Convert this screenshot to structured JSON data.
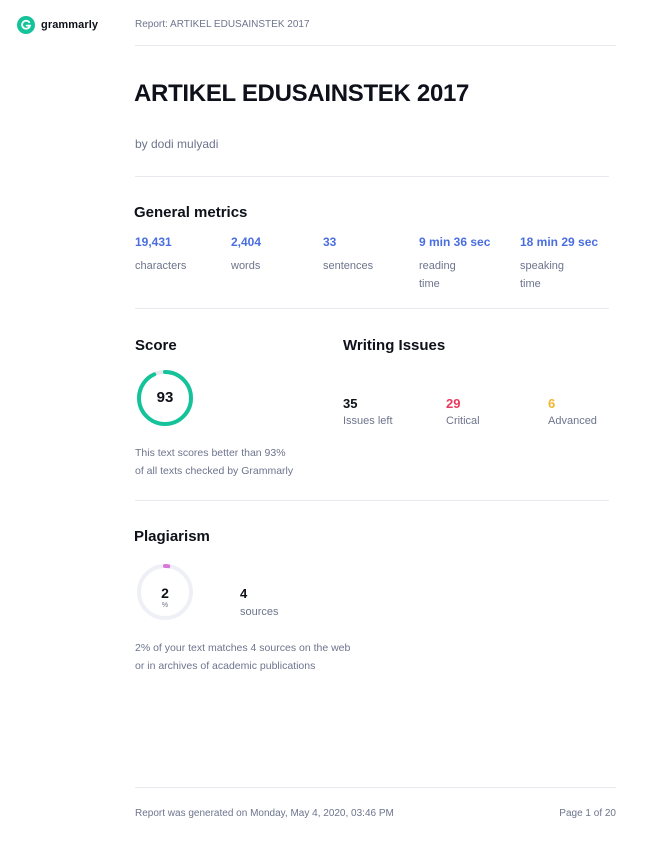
{
  "header": {
    "brand_name": "grammarly",
    "report_title": "Report: ARTIKEL EDUSAINSTEK 2017"
  },
  "document": {
    "title": "ARTIKEL EDUSAINSTEK 2017",
    "author": "by dodi mulyadi"
  },
  "general_metrics": {
    "heading": "General metrics",
    "items": [
      {
        "value": "19,431",
        "label": "characters"
      },
      {
        "value": "2,404",
        "label": "words"
      },
      {
        "value": "33",
        "label": "sentences"
      },
      {
        "value": "9 min 36 sec",
        "label_line1": "reading",
        "label_line2": "time"
      },
      {
        "value": "18 min 29 sec",
        "label_line1": "speaking",
        "label_line2": "time"
      }
    ]
  },
  "score": {
    "heading": "Score",
    "value": "93",
    "percent": 93,
    "description_line1": "This text scores better than 93%",
    "description_line2": "of all texts checked by Grammarly",
    "ring_color": "#15c39a"
  },
  "writing_issues": {
    "heading": "Writing Issues",
    "issues_left": {
      "value": "35",
      "label": "Issues left",
      "color": "#0e101a"
    },
    "critical": {
      "value": "29",
      "label": "Critical",
      "color": "#e73b60"
    },
    "advanced": {
      "value": "6",
      "label": "Advanced",
      "color": "#f2b630"
    }
  },
  "plagiarism": {
    "heading": "Plagiarism",
    "percent_value": "2",
    "percent_symbol": "%",
    "percent": 2,
    "sources_value": "4",
    "sources_label": "sources",
    "description_line1": "2% of your text matches 4 sources on the web",
    "description_line2": "or in archives of academic publications",
    "ring_color": "#d777d9"
  },
  "footer": {
    "generated": "Report was generated on Monday, May 4, 2020, 03:46 PM",
    "page": "Page 1 of 20"
  }
}
